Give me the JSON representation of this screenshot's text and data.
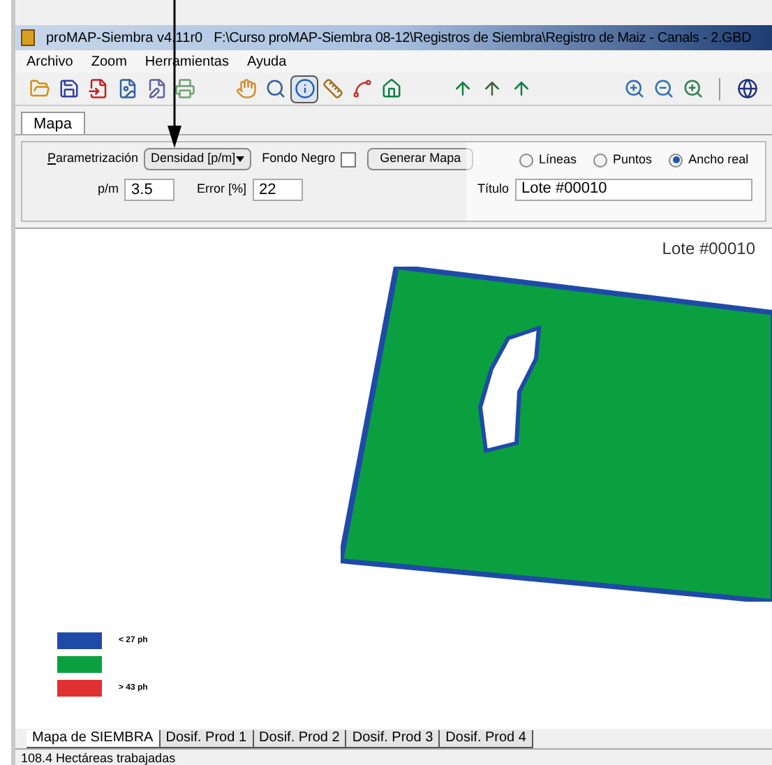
{
  "window": {
    "title": "proMAP-Siembra v4.11r0",
    "path": "F:\\Curso proMAP-Siembra 08-12\\Registros de Siembra\\Registro de Maiz - Canals - 2.GBD"
  },
  "menu": [
    "Archivo",
    "Zoom",
    "Herramientas",
    "Ayuda"
  ],
  "tabs": [
    {
      "label": "Mapa",
      "selected": true
    }
  ],
  "form": {
    "param_label": "Parametrización",
    "param_value": "Densidad [p/m]",
    "fondo_label": "Fondo Negro",
    "fondo_checked": false,
    "generate": "Generar Mapa",
    "pm_label": "p/m",
    "pm_value": "3.5",
    "error_label": "Error [%]",
    "error_value": "22",
    "radios": [
      {
        "label": "Líneas",
        "selected": false
      },
      {
        "label": "Puntos",
        "selected": false
      },
      {
        "label": "Ancho real",
        "selected": true
      }
    ],
    "title_label": "Título",
    "title_value": "Lote #00010"
  },
  "map": {
    "title": "Lote #00010",
    "legend": [
      {
        "label": "< 27 ph",
        "color": "#1f4aa8"
      },
      {
        "color": "#0aa040"
      },
      {
        "label": "> 43 ph",
        "color": "#e03030"
      }
    ]
  },
  "sheet_tabs": [
    {
      "label": "Mapa de SIEMBRA",
      "selected": true
    },
    {
      "label": "Dosif. Prod 1",
      "selected": false
    },
    {
      "label": "Dosif. Prod 2",
      "selected": false
    },
    {
      "label": "Dosif. Prod 3",
      "selected": false
    },
    {
      "label": "Dosif. Prod 4",
      "selected": false
    }
  ],
  "status_bar": "108.4 Hectáreas trabajadas"
}
